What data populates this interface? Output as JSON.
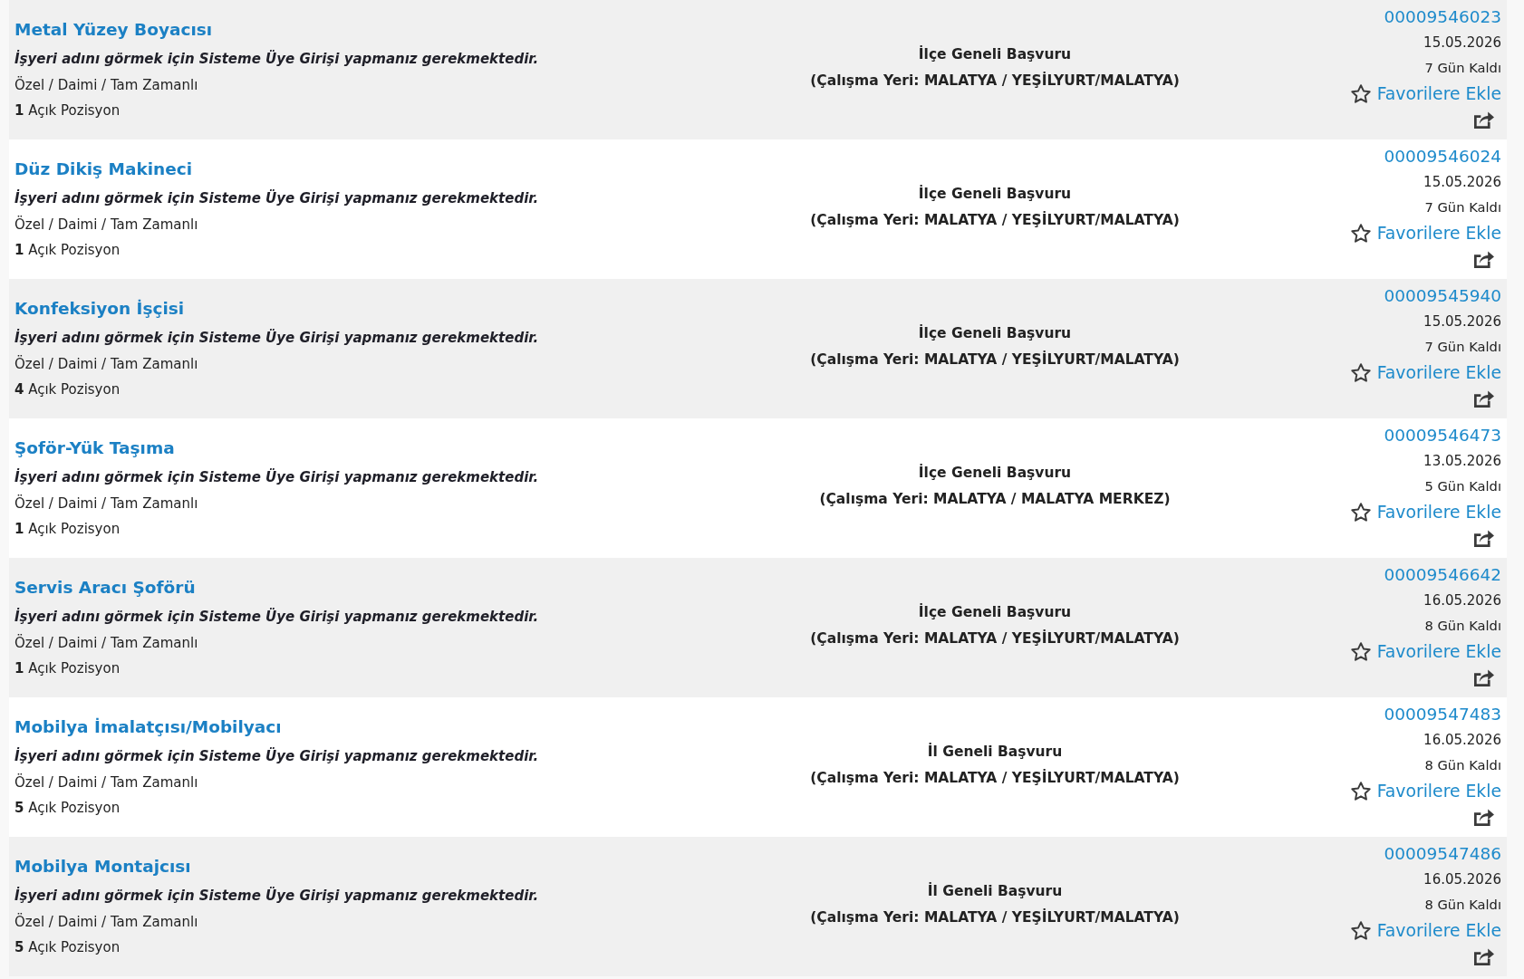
{
  "listings": [
    {
      "title": "Metal Yüzey Boyacısı",
      "employer_note": "İşyeri adını görmek için Sisteme Üye Girişi yapmanız gerekmektedir.",
      "employment_type": "Özel / Daimi / Tam Zamanlı",
      "open_positions": "**1** Açık Pozisyon",
      "application_scope": "İlçe Geneli Başvuru",
      "work_location": "(Çalışma Yeri: MALATYA / YEŞİLYURT/MALATYA)",
      "listing_no": "00009546023",
      "deadline": "15.05.2026",
      "days_left": "7 Gün Kaldı",
      "favorite_label": "Favorilere Ekle"
    },
    {
      "title": "Düz Dikiş Makineci",
      "employer_note": "İşyeri adını görmek için Sisteme Üye Girişi yapmanız gerekmektedir.",
      "employment_type": "Özel / Daimi / Tam Zamanlı",
      "open_positions": "**1** Açık Pozisyon",
      "application_scope": "İlçe Geneli Başvuru",
      "work_location": "(Çalışma Yeri: MALATYA / YEŞİLYURT/MALATYA)",
      "listing_no": "00009546024",
      "deadline": "15.05.2026",
      "days_left": "7 Gün Kaldı",
      "favorite_label": "Favorilere Ekle"
    },
    {
      "title": "Konfeksiyon İşçisi",
      "employer_note": "İşyeri adını görmek için Sisteme Üye Girişi yapmanız gerekmektedir.",
      "employment_type": "Özel / Daimi / Tam Zamanlı",
      "open_positions": "**4** Açık Pozisyon",
      "application_scope": "İlçe Geneli Başvuru",
      "work_location": "(Çalışma Yeri: MALATYA / YEŞİLYURT/MALATYA)",
      "listing_no": "00009545940",
      "deadline": "15.05.2026",
      "days_left": "7 Gün Kaldı",
      "favorite_label": "Favorilere Ekle"
    },
    {
      "title": "Şoför-Yük Taşıma",
      "employer_note": "İşyeri adını görmek için Sisteme Üye Girişi yapmanız gerekmektedir.",
      "employment_type": "Özel / Daimi / Tam Zamanlı",
      "open_positions": "**1** Açık Pozisyon",
      "application_scope": "İlçe Geneli Başvuru",
      "work_location": "(Çalışma Yeri: MALATYA / MALATYA MERKEZ)",
      "listing_no": "00009546473",
      "deadline": "13.05.2026",
      "days_left": "5 Gün Kaldı",
      "favorite_label": "Favorilere Ekle"
    },
    {
      "title": "Servis Aracı Şoförü",
      "employer_note": "İşyeri adını görmek için Sisteme Üye Girişi yapmanız gerekmektedir.",
      "employment_type": "Özel / Daimi / Tam Zamanlı",
      "open_positions": "**1** Açık Pozisyon",
      "application_scope": "İlçe Geneli Başvuru",
      "work_location": "(Çalışma Yeri: MALATYA / YEŞİLYURT/MALATYA)",
      "listing_no": "00009546642",
      "deadline": "16.05.2026",
      "days_left": "8 Gün Kaldı",
      "favorite_label": "Favorilere Ekle"
    },
    {
      "title": "Mobilya İmalatçısı/Mobilyacı",
      "employer_note": "İşyeri adını görmek için Sisteme Üye Girişi yapmanız gerekmektedir.",
      "employment_type": "Özel / Daimi / Tam Zamanlı",
      "open_positions": "**5** Açık Pozisyon",
      "application_scope": "İl Geneli Başvuru",
      "work_location": "(Çalışma Yeri: MALATYA / YEŞİLYURT/MALATYA)",
      "listing_no": "00009547483",
      "deadline": "16.05.2026",
      "days_left": "8 Gün Kaldı",
      "favorite_label": "Favorilere Ekle"
    },
    {
      "title": "Mobilya Montajcısı",
      "employer_note": "İşyeri adını görmek için Sisteme Üye Girişi yapmanız gerekmektedir.",
      "employment_type": "Özel / Daimi / Tam Zamanlı",
      "open_positions": "**5** Açık Pozisyon",
      "application_scope": "İl Geneli Başvuru",
      "work_location": "(Çalışma Yeri: MALATYA / YEŞİLYURT/MALATYA)",
      "listing_no": "00009547486",
      "deadline": "16.05.2026",
      "days_left": "8 Gün Kaldı",
      "favorite_label": "Favorilere Ekle"
    }
  ]
}
